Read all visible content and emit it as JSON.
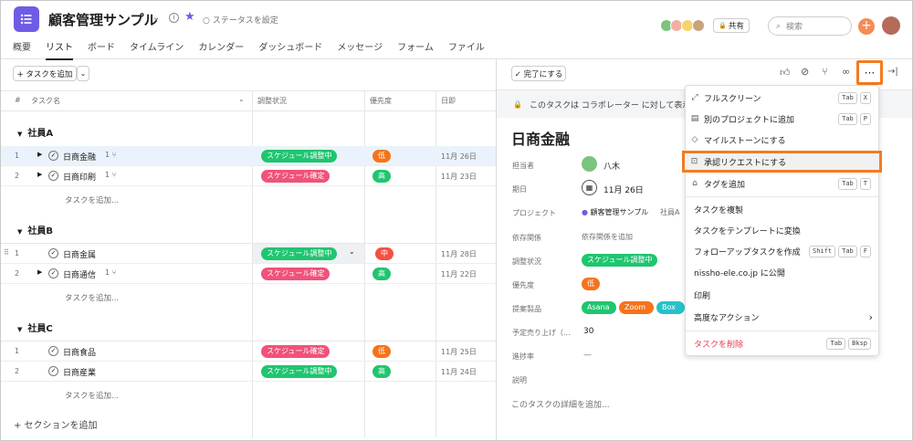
{
  "header": {
    "title": "顧客管理サンプル",
    "status": "ステータスを設定",
    "share": "共有",
    "search_placeholder": "検索"
  },
  "tabs": [
    "概要",
    "リスト",
    "ボード",
    "タイムライン",
    "カレンダー",
    "ダッシュボード",
    "メッセージ",
    "フォーム",
    "ファイル"
  ],
  "toolbar": {
    "add_task": "+ タスクを追加"
  },
  "columns": {
    "num": "#",
    "name": "タスク名",
    "status": "調整状況",
    "priority": "優先度",
    "date": "日即"
  },
  "sections": [
    {
      "name": "社員A",
      "tasks": [
        {
          "num": "1",
          "name": "日商金融",
          "sub": "1",
          "status": "スケジュール調整中",
          "status_color": "green",
          "priority": "低",
          "priority_color": "orange",
          "date": "11月 26日"
        },
        {
          "num": "2",
          "name": "日商印刷",
          "sub": "1",
          "status": "スケジュール確定",
          "status_color": "pink",
          "priority": "高",
          "priority_color": "green",
          "date": "11月 23日"
        }
      ]
    },
    {
      "name": "社員B",
      "tasks": [
        {
          "num": "1",
          "name": "日商金属",
          "sub": "",
          "status": "スケジュール調整中",
          "status_color": "green",
          "priority": "中",
          "priority_color": "red",
          "date": "11月 28日"
        },
        {
          "num": "2",
          "name": "日商通信",
          "sub": "1",
          "status": "スケジュール確定",
          "status_color": "pink",
          "priority": "高",
          "priority_color": "green",
          "date": "11月 22日"
        }
      ]
    },
    {
      "name": "社員C",
      "tasks": [
        {
          "num": "1",
          "name": "日商食品",
          "sub": "",
          "status": "スケジュール確定",
          "status_color": "pink",
          "priority": "低",
          "priority_color": "orange",
          "date": "11月 25日"
        },
        {
          "num": "2",
          "name": "日商産業",
          "sub": "",
          "status": "スケジュール調整中",
          "status_color": "green",
          "priority": "高",
          "priority_color": "green",
          "date": "11月 24日"
        }
      ]
    }
  ],
  "add_task_inline": "タスクを追加...",
  "add_section": "+ セクションを追加",
  "detail": {
    "complete_btn": "✓ 完了にする",
    "banner": "このタスクは コラボレーター に対して表示",
    "title": "日商金融",
    "assignee_label": "担当者",
    "assignee": "八木",
    "due_label": "期日",
    "due": "11月 26日",
    "project_label": "プロジェクト",
    "project": "顧客管理サンプル",
    "project_section": "社員A",
    "dependency_label": "依存関係",
    "dependency": "依存関係を追加",
    "status_label": "調整状況",
    "status": "スケジュール調整中",
    "priority_label": "優先度",
    "priority": "低",
    "products_label": "提案製品",
    "products": [
      "Asana",
      "Zoom",
      "Box"
    ],
    "sales_label": "予定売り上げ（...",
    "sales": "30",
    "progress_label": "進捗率",
    "progress": "—",
    "desc_label": "説明",
    "desc_placeholder": "このタスクの詳細を追加..."
  },
  "menu": {
    "items": [
      {
        "label": "フルスクリーン",
        "keys": [
          "Tab",
          "X"
        ]
      },
      {
        "label": "別のプロジェクトに追加",
        "keys": [
          "Tab",
          "P"
        ]
      },
      {
        "label": "マイルストーンにする",
        "keys": []
      },
      {
        "label": "承認リクエストにする",
        "keys": []
      },
      {
        "label": "タグを追加",
        "keys": [
          "Tab",
          "T"
        ]
      },
      {
        "label": "タスクを複製",
        "keys": []
      },
      {
        "label": "タスクをテンプレートに変換",
        "keys": []
      },
      {
        "label": "フォローアップタスクを作成",
        "keys": [
          "Shift",
          "Tab",
          "F"
        ]
      },
      {
        "label": "nissho-ele.co.jp に公開",
        "keys": []
      },
      {
        "label": "印刷",
        "keys": []
      },
      {
        "label": "高度なアクション",
        "keys": []
      },
      {
        "label": "タスクを削除",
        "keys": [
          "Tab",
          "Bksp"
        ]
      }
    ]
  },
  "colors": {
    "accent": "#6e5ce6",
    "highlight": "#f47b20",
    "green": "#1fc56f",
    "pink": "#f0527a",
    "orange": "#f7731a",
    "red": "#f35044"
  }
}
